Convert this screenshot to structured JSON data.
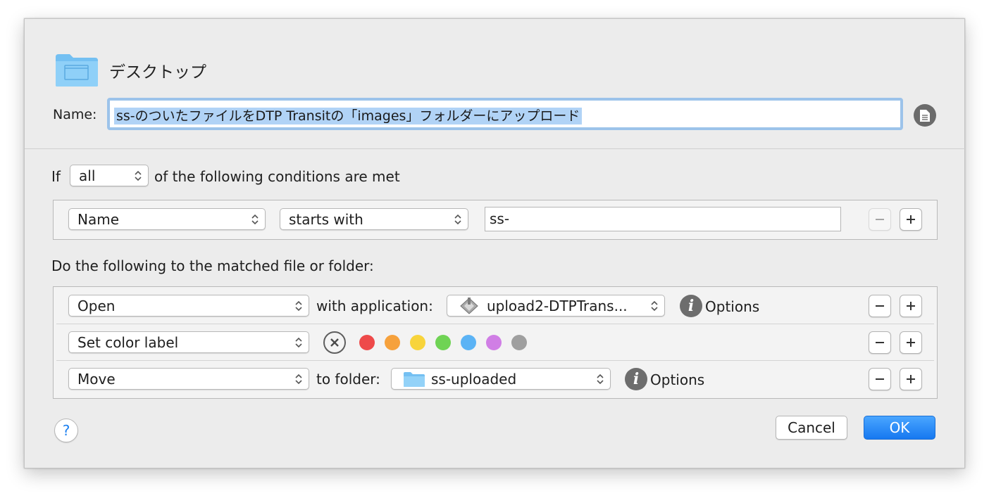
{
  "header": {
    "folder_name": "デスクトップ",
    "name_label": "Name:",
    "name_value": "ss-のついたファイルをDTP Transitの「images」フォルダーにアップロード",
    "doc_icon": "document-icon"
  },
  "conditions": {
    "if_label": "If",
    "match_mode": "all",
    "suffix": "of the following conditions are met",
    "rows": [
      {
        "attribute": "Name",
        "operator": "starts with",
        "value": "ss-"
      }
    ]
  },
  "actions": {
    "heading": "Do the following to the matched file or folder:",
    "rows": [
      {
        "action": "Open",
        "connector": "with application:",
        "target": "upload2-DTPTrans...",
        "options": "Options"
      },
      {
        "action": "Set color label",
        "colors": [
          "#ee4a4a",
          "#f6a13c",
          "#f8d43b",
          "#6fd354",
          "#5bb3f5",
          "#d07ee5",
          "#9f9f9f"
        ]
      },
      {
        "action": "Move",
        "connector": "to folder:",
        "target": "ss-uploaded",
        "options": "Options"
      }
    ]
  },
  "footer": {
    "help": "?",
    "cancel": "Cancel",
    "ok": "OK"
  },
  "colors": {
    "accent": "#1a7ff0",
    "selection": "#b1d3f6",
    "focus_ring": "#9cc3ea"
  }
}
